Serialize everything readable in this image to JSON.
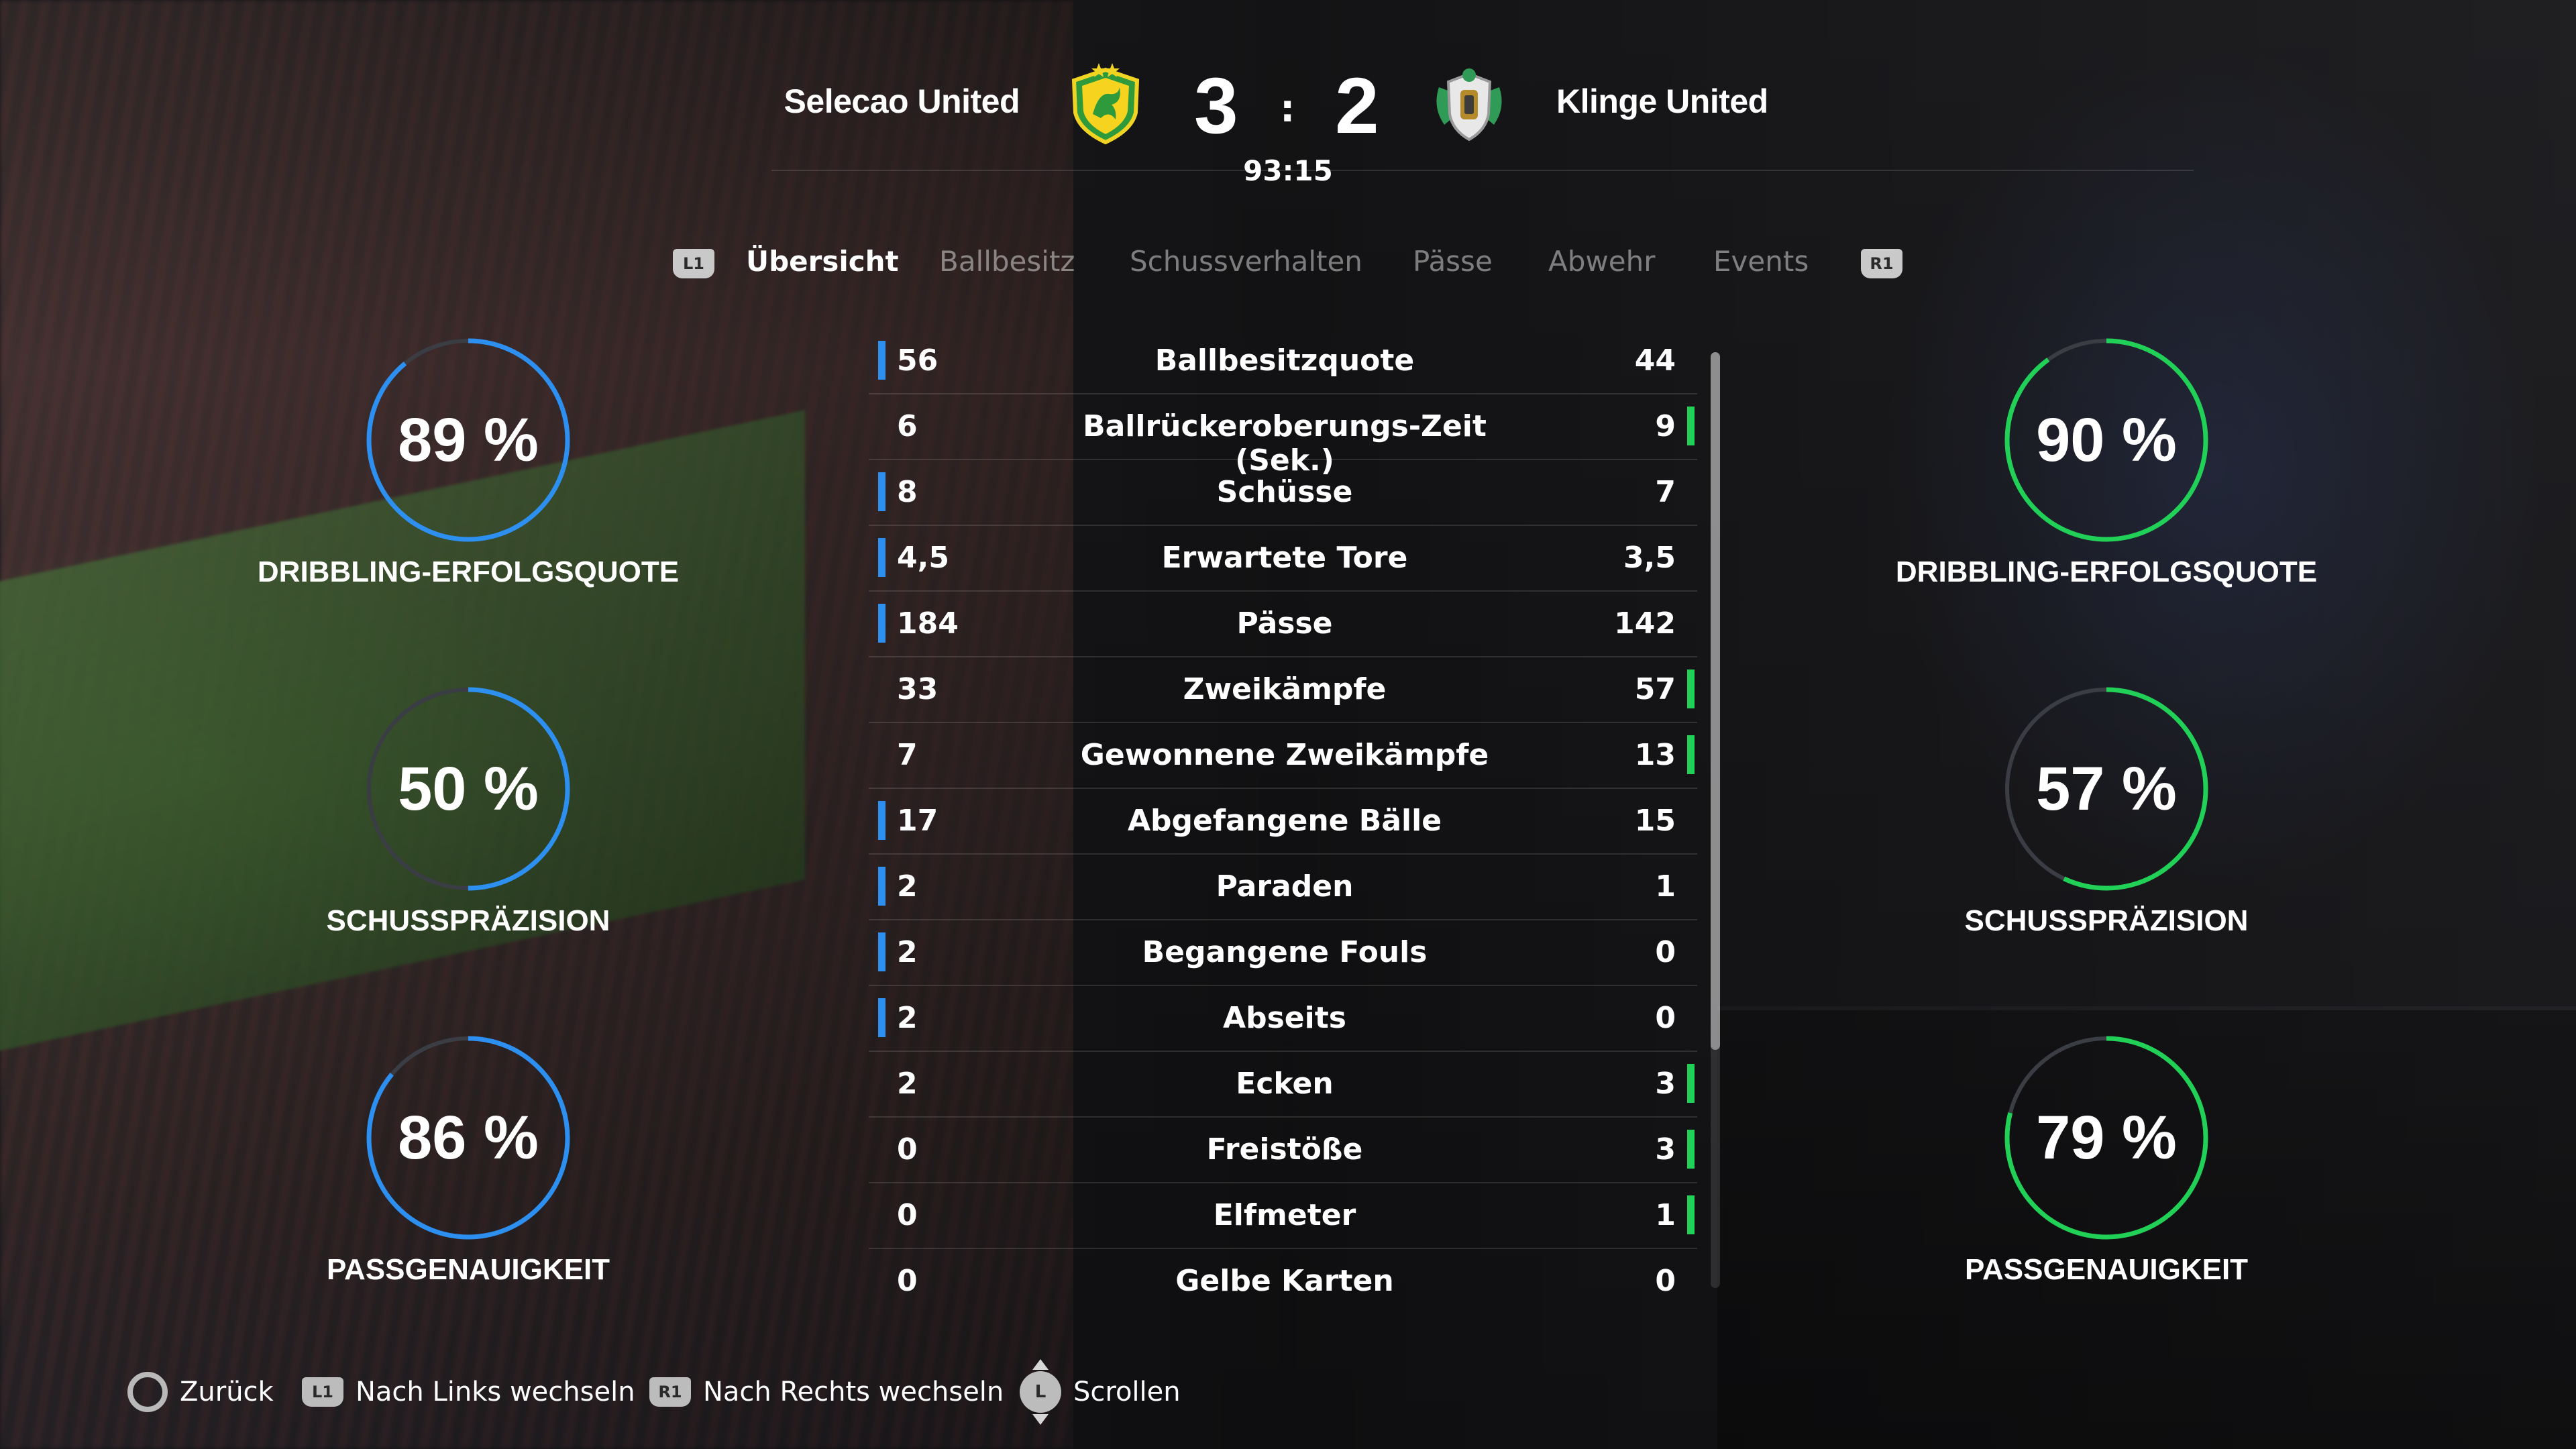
{
  "match": {
    "home_team": "Selecao United",
    "away_team": "Klinge United",
    "home_score": "3",
    "away_score": "2",
    "separator": ":",
    "clock": "93:15"
  },
  "tabs": {
    "left_shoulder": "L1",
    "right_shoulder": "R1",
    "items": [
      "Übersicht",
      "Ballbesitz",
      "Schussverhalten",
      "Pässe",
      "Abwehr",
      "Events"
    ],
    "active_index": 0
  },
  "home_rings": [
    {
      "value": "89 %",
      "percent": 89,
      "label": "DRIBBLING-ERFOLGSQUOTE"
    },
    {
      "value": "50 %",
      "percent": 50,
      "label": "SCHUSSPRÄZISION"
    },
    {
      "value": "86 %",
      "percent": 86,
      "label": "PASSGENAUIGKEIT"
    }
  ],
  "away_rings": [
    {
      "value": "90 %",
      "percent": 90,
      "label": "DRIBBLING-ERFOLGSQUOTE"
    },
    {
      "value": "57 %",
      "percent": 57,
      "label": "SCHUSSPRÄZISION"
    },
    {
      "value": "79 %",
      "percent": 79,
      "label": "PASSGENAUIGKEIT"
    }
  ],
  "stats": [
    {
      "label": "Ballbesitzquote",
      "home": "56",
      "away": "44",
      "leader": "home"
    },
    {
      "label": "Ballrückeroberungs-Zeit (Sek.)",
      "home": "6",
      "away": "9",
      "leader": "away"
    },
    {
      "label": "Schüsse",
      "home": "8",
      "away": "7",
      "leader": "home"
    },
    {
      "label": "Erwartete Tore",
      "home": "4,5",
      "away": "3,5",
      "leader": "home"
    },
    {
      "label": "Pässe",
      "home": "184",
      "away": "142",
      "leader": "home"
    },
    {
      "label": "Zweikämpfe",
      "home": "33",
      "away": "57",
      "leader": "away"
    },
    {
      "label": "Gewonnene Zweikämpfe",
      "home": "7",
      "away": "13",
      "leader": "away"
    },
    {
      "label": "Abgefangene Bälle",
      "home": "17",
      "away": "15",
      "leader": "home"
    },
    {
      "label": "Paraden",
      "home": "2",
      "away": "1",
      "leader": "home"
    },
    {
      "label": "Begangene Fouls",
      "home": "2",
      "away": "0",
      "leader": "home"
    },
    {
      "label": "Abseits",
      "home": "2",
      "away": "0",
      "leader": "home"
    },
    {
      "label": "Ecken",
      "home": "2",
      "away": "3",
      "leader": "away"
    },
    {
      "label": "Freistöße",
      "home": "0",
      "away": "3",
      "leader": "away"
    },
    {
      "label": "Elfmeter",
      "home": "0",
      "away": "1",
      "leader": "away"
    },
    {
      "label": "Gelbe Karten",
      "home": "0",
      "away": "0",
      "leader": "none"
    }
  ],
  "footer": {
    "back_label": "Zurück",
    "left_label": "Nach Links wechseln",
    "right_label": "Nach Rechts wechseln",
    "scroll_label": "Scrollen",
    "l1": "L1",
    "r1": "R1",
    "stick": "L"
  },
  "colors": {
    "home_accent": "#2d8ff0",
    "away_accent": "#21d157",
    "ring_track": "#3a3d44"
  },
  "icons": {
    "back": "circle-button-icon",
    "home_crest": "selecao-united-crest-icon",
    "away_crest": "klinge-united-crest-icon",
    "scroll": "left-stick-icon"
  }
}
